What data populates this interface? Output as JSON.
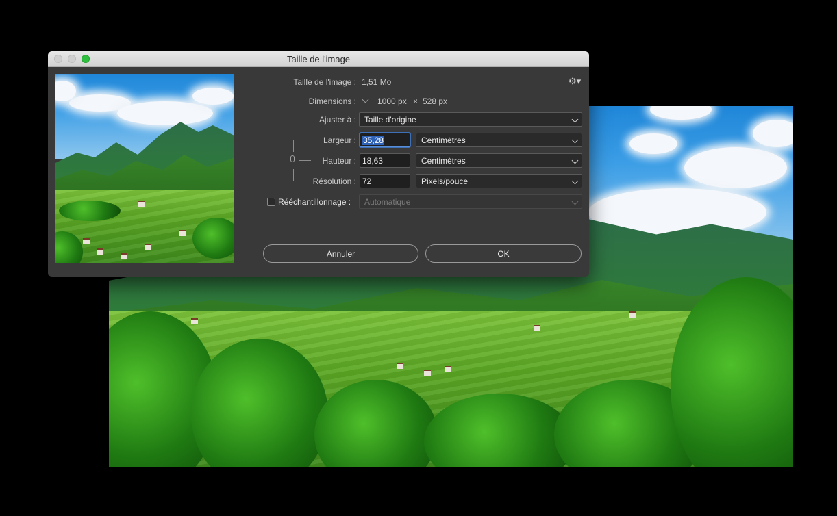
{
  "dialog": {
    "title": "Taille de l'image",
    "image_size_label": "Taille de l'image :",
    "image_size_value": "1,51 Mo",
    "dimensions_label": "Dimensions :",
    "dimensions_width": "1000 px",
    "dimensions_times": "×",
    "dimensions_height": "528 px",
    "fit_to_label": "Ajuster à :",
    "fit_to_value": "Taille d'origine",
    "width_label": "Largeur :",
    "width_value": "35,28",
    "width_unit": "Centimètres",
    "height_label": "Hauteur :",
    "height_value": "18,63",
    "height_unit": "Centimètres",
    "resolution_label": "Résolution :",
    "resolution_value": "72",
    "resolution_unit": "Pixels/pouce",
    "resample_label": "Rééchantillonnage :",
    "resample_value": "Automatique",
    "resample_checked": false,
    "cancel_label": "Annuler",
    "ok_label": "OK"
  },
  "icons": {
    "settings": "gear-icon",
    "link": "chain-link-icon"
  }
}
